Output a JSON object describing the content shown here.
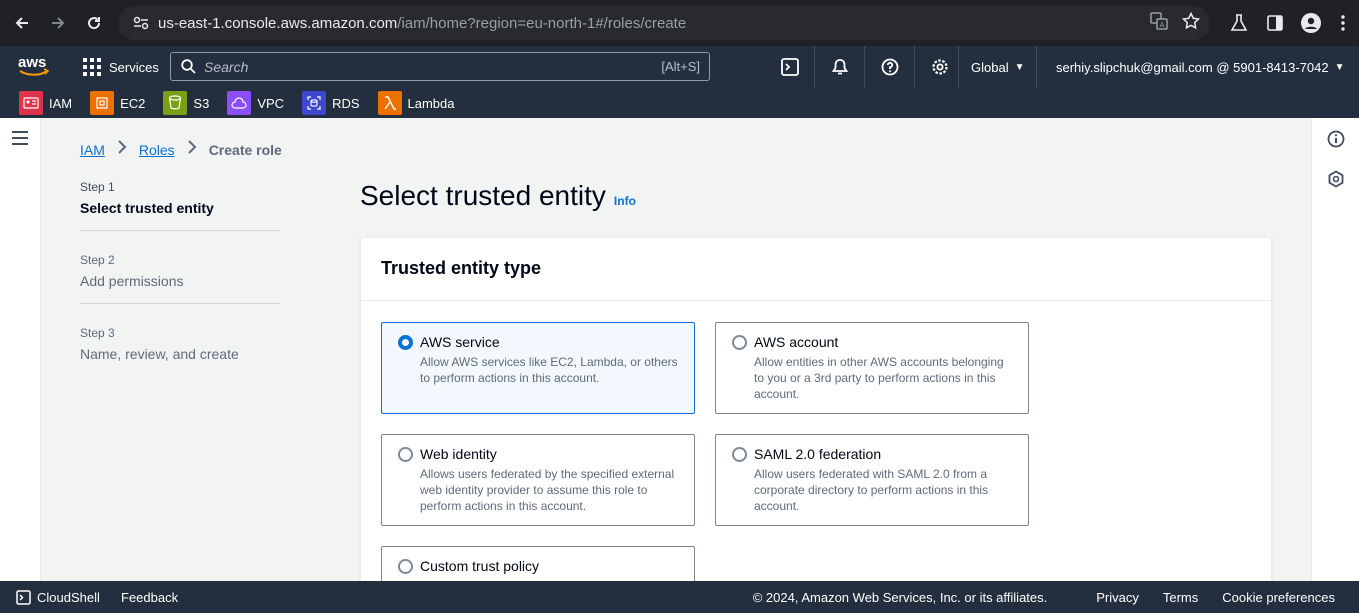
{
  "browser": {
    "url_host": "us-east-1.console.aws.amazon.com",
    "url_path": "/iam/home?region=eu-north-1#/roles/create"
  },
  "aws_nav": {
    "logo_text": "aws",
    "services_label": "Services",
    "search_placeholder": "Search",
    "search_shortcut": "[Alt+S]",
    "region_label": "Global",
    "account_label": "serhiy.slipchuk@gmail.com @ 5901-8413-7042"
  },
  "favorites": [
    {
      "label": "IAM",
      "color": "#dd344c"
    },
    {
      "label": "EC2",
      "color": "#ed7100"
    },
    {
      "label": "S3",
      "color": "#7aa116"
    },
    {
      "label": "VPC",
      "color": "#8c4fff"
    },
    {
      "label": "RDS",
      "color": "#3f48cc"
    },
    {
      "label": "Lambda",
      "color": "#ed7100"
    }
  ],
  "breadcrumb": {
    "items": [
      "IAM",
      "Roles"
    ],
    "current": "Create role"
  },
  "steps": [
    {
      "num": "Step 1",
      "title": "Select trusted entity"
    },
    {
      "num": "Step 2",
      "title": "Add permissions"
    },
    {
      "num": "Step 3",
      "title": "Name, review, and create"
    }
  ],
  "main": {
    "title": "Select trusted entity",
    "info": "Info",
    "section_title": "Trusted entity type",
    "options": [
      {
        "title": "AWS service",
        "desc": "Allow AWS services like EC2, Lambda, or others to perform actions in this account.",
        "selected": true
      },
      {
        "title": "AWS account",
        "desc": "Allow entities in other AWS accounts belonging to you or a 3rd party to perform actions in this account.",
        "selected": false
      },
      {
        "title": "Web identity",
        "desc": "Allows users federated by the specified external web identity provider to assume this role to perform actions in this account.",
        "selected": false
      },
      {
        "title": "SAML 2.0 federation",
        "desc": "Allow users federated with SAML 2.0 from a corporate directory to perform actions in this account.",
        "selected": false
      },
      {
        "title": "Custom trust policy",
        "desc": "",
        "selected": false
      }
    ]
  },
  "footer": {
    "cloudshell": "CloudShell",
    "feedback": "Feedback",
    "copyright": "© 2024, Amazon Web Services, Inc. or its affiliates.",
    "privacy": "Privacy",
    "terms": "Terms",
    "cookies": "Cookie preferences"
  }
}
